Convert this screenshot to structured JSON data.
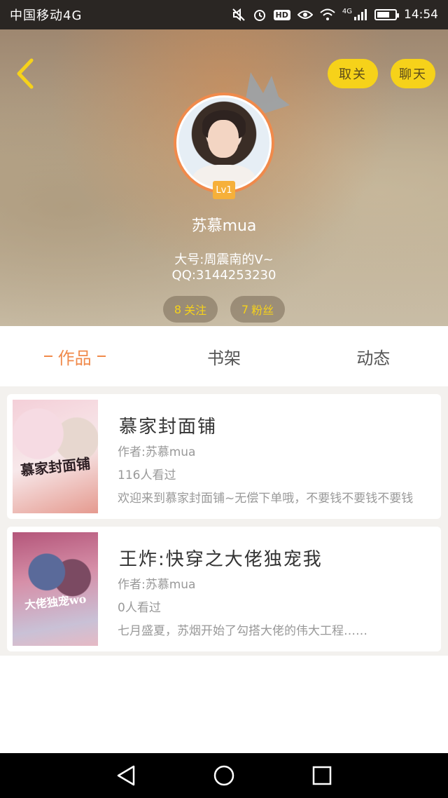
{
  "status_bar": {
    "carrier": "中国移动4G",
    "network": "4G",
    "time": "14:54",
    "hd_label": "HD",
    "battery_percent": 70
  },
  "header": {
    "unfollow_label": "取关",
    "chat_label": "聊天",
    "level": "Lv1",
    "username": "苏慕mua",
    "bio_lines": [
      "大号:周震南的V~",
      "QQ:3144253230"
    ],
    "following_count": "8",
    "following_label": "关注",
    "followers_count": "7",
    "followers_label": "粉丝"
  },
  "tabs": [
    {
      "label": "作品",
      "active": true
    },
    {
      "label": "书架",
      "active": false
    },
    {
      "label": "动态",
      "active": false
    }
  ],
  "books": [
    {
      "title": "慕家封面铺",
      "author": "作者:苏慕mua",
      "views": "116人看过",
      "description": "欢迎来到慕家封面铺~无偿下单哦，不要钱不要钱不要钱",
      "cover_text": "慕家封面铺"
    },
    {
      "title": "王炸:快穿之大佬独宠我",
      "author": "作者:苏慕mua",
      "views": "0人看过",
      "description": "七月盛夏，苏烟开始了勾搭大佬的伟大工程……",
      "cover_text": "大佬独宠wo"
    }
  ],
  "colors": {
    "accent_yellow": "#f6d21a",
    "accent_orange": "#f08a4b",
    "status_bar_bg": "#2a2623",
    "nav_bar_bg": "#000000"
  },
  "icons": {
    "back": "chevron-left-icon",
    "mute": "mute-icon",
    "alarm": "alarm-icon",
    "eye": "eye-icon",
    "wifi": "wifi-icon",
    "signal": "signal-icon",
    "battery": "battery-icon",
    "nav_back": "triangle-back-icon",
    "nav_home": "circle-home-icon",
    "nav_recent": "square-recent-icon"
  }
}
